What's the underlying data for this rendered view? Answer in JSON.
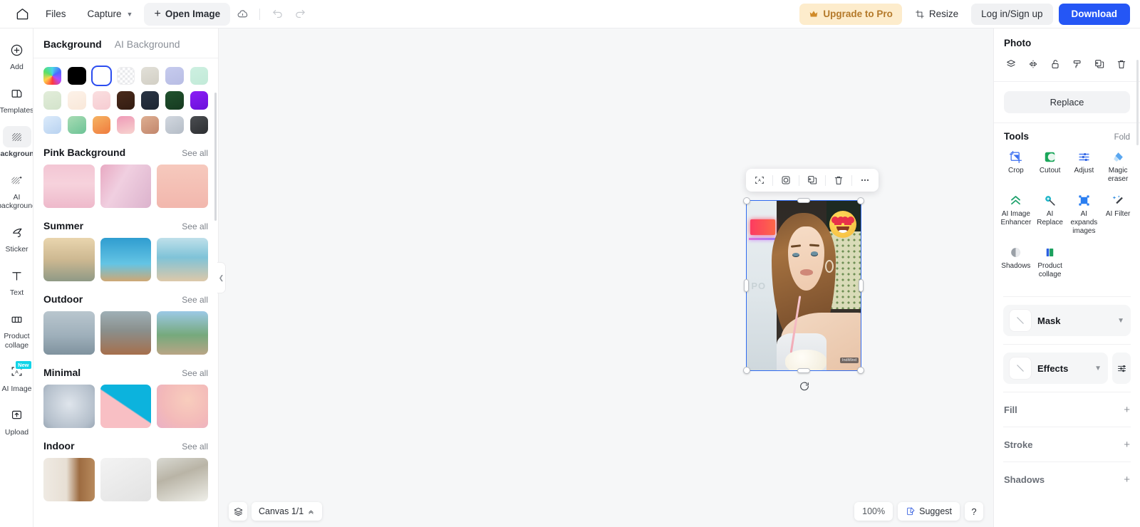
{
  "topbar": {
    "home_icon": "home-icon",
    "files_label": "Files",
    "capture_label": "Capture",
    "open_image_label": "Open Image",
    "cloud_icon": "cloud-upload-icon",
    "undo_icon": "undo-icon",
    "redo_icon": "redo-icon",
    "upgrade_label": "Upgrade to Pro",
    "crown_icon": "crown-icon",
    "resize_label": "Resize",
    "resize_icon": "resize-icon",
    "login_label": "Log in/Sign up",
    "download_label": "Download",
    "accent_blue": "#2556f5",
    "pro_bg": "#fdeccc",
    "pro_text": "#b4792a"
  },
  "rail": {
    "items": [
      {
        "label": "Add",
        "icon": "plus-circle-icon",
        "active": false,
        "badge": ""
      },
      {
        "label": "Templates",
        "icon": "templates-icon",
        "active": false,
        "badge": ""
      },
      {
        "label": "Background",
        "icon": "background-hatch-icon",
        "active": true,
        "badge": ""
      },
      {
        "label": "AI background",
        "icon": "ai-background-icon",
        "active": false,
        "badge": ""
      },
      {
        "label": "Sticker",
        "icon": "sticker-icon",
        "active": false,
        "badge": ""
      },
      {
        "label": "Text",
        "icon": "text-icon",
        "active": false,
        "badge": ""
      },
      {
        "label": "Product collage",
        "icon": "product-collage-icon",
        "active": false,
        "badge": ""
      },
      {
        "label": "AI Image",
        "icon": "ai-image-icon",
        "active": false,
        "badge": "New"
      },
      {
        "label": "Upload",
        "icon": "upload-icon",
        "active": false,
        "badge": ""
      }
    ]
  },
  "panel": {
    "tabs": [
      {
        "label": "Background",
        "active": true
      },
      {
        "label": "AI Background",
        "active": false
      }
    ],
    "swatches": [
      {
        "name": "rainbow",
        "type": "rainbow",
        "selected": false
      },
      {
        "name": "black",
        "color": "#000000",
        "selected": false
      },
      {
        "name": "white",
        "color": "#ffffff",
        "selected": true
      },
      {
        "name": "transparent",
        "type": "checker",
        "selected": false
      },
      {
        "name": "warm-grey",
        "color": "#d8d5cd",
        "selected": false
      },
      {
        "name": "periwinkle",
        "color": "#c0c4e8",
        "selected": false
      },
      {
        "name": "mint",
        "color": "#c9ecdd",
        "selected": false
      },
      {
        "name": "pale-green",
        "color": "#dbe7d4",
        "selected": false
      },
      {
        "name": "cream",
        "color": "#fbeee2",
        "selected": false
      },
      {
        "name": "blush",
        "color": "#f8d7d9",
        "selected": false
      },
      {
        "name": "dark-brown",
        "color": "#3e2418",
        "selected": false
      },
      {
        "name": "navy",
        "color": "#222c3a",
        "selected": false
      },
      {
        "name": "forest",
        "color": "#1e4a2a",
        "selected": false
      },
      {
        "name": "violet",
        "color": "#7a18f0",
        "selected": false
      },
      {
        "name": "sky-gradient",
        "color": "#cfe2f7",
        "selected": false
      },
      {
        "name": "green-gradient",
        "color": "#8fd2a6",
        "selected": false
      },
      {
        "name": "orange-gradient",
        "color": "#f49a4e",
        "selected": false
      },
      {
        "name": "pink-gradient",
        "color": "#efa9bd",
        "selected": false
      },
      {
        "name": "tan-gradient",
        "color": "#d3a085",
        "selected": false
      },
      {
        "name": "silver-gradient",
        "color": "#c3c9d2",
        "selected": false
      },
      {
        "name": "charcoal-gradient",
        "color": "#3a3d40",
        "selected": false
      }
    ],
    "see_all_label": "See all",
    "categories": [
      {
        "title": "Pink Background",
        "thumbs": [
          "pink-petals-podium",
          "pink-curtain-window",
          "pink-tulips-wall"
        ]
      },
      {
        "title": "Summer",
        "thumbs": [
          "beach-palm-stone",
          "pool-water-deck",
          "sandy-beach-sea"
        ]
      },
      {
        "title": "Outdoor",
        "thumbs": [
          "wet-stone-path",
          "cliff-coast-wood",
          "mountain-forest-road"
        ]
      },
      {
        "title": "Minimal",
        "thumbs": [
          "grey-radial-gradient",
          "cyan-pink-diagonal",
          "peach-pink-blur"
        ]
      },
      {
        "title": "Indoor",
        "thumbs": [
          "curtain-wood-wall",
          "white-wall-corner",
          "window-white-flowers"
        ]
      }
    ],
    "collapse_icon": "chevron-left-icon"
  },
  "canvas": {
    "float_tools": [
      {
        "name": "ai-select-icon"
      },
      {
        "name": "cutout-icon"
      },
      {
        "name": "duplicate-icon"
      },
      {
        "name": "delete-icon"
      },
      {
        "name": "more-icon"
      }
    ],
    "rotate_icon": "rotate-icon",
    "image_watermark": "IndiWed",
    "bottom": {
      "layers_icon": "layers-icon",
      "canvas_label": "Canvas 1/1",
      "canvas_caret_icon": "chevron-up-icon",
      "zoom_level": "100%",
      "suggest_label": "Suggest",
      "suggest_icon": "suggest-note-icon",
      "help_label": "?"
    }
  },
  "right_panel": {
    "title": "Photo",
    "header_icons": [
      {
        "name": "layers-order-icon"
      },
      {
        "name": "flip-horizontal-icon"
      },
      {
        "name": "unlock-icon"
      },
      {
        "name": "paint-format-icon"
      },
      {
        "name": "duplicate-icon"
      },
      {
        "name": "delete-icon"
      }
    ],
    "replace_label": "Replace",
    "tools_title": "Tools",
    "fold_label": "Fold",
    "tools": [
      {
        "label": "Crop",
        "icon": "crop-icon",
        "color": "#3b6ff0"
      },
      {
        "label": "Cutout",
        "icon": "cutout-icon",
        "color": "#1aa65a"
      },
      {
        "label": "Adjust",
        "icon": "adjust-icon",
        "color": "#4a7df5"
      },
      {
        "label": "Magic eraser",
        "icon": "magic-eraser-icon",
        "color": "#5aa7f0"
      },
      {
        "label": "AI Image Enhancer",
        "icon": "chevrons-up-icon",
        "color": "#1ba06a"
      },
      {
        "label": "AI Replace",
        "icon": "ai-replace-icon",
        "color": "#1fb5c8"
      },
      {
        "label": "AI expands images",
        "icon": "expand-icon",
        "color": "#2a7ef0"
      },
      {
        "label": "AI Filter",
        "icon": "ai-filter-icon",
        "color": "#2f8ce0"
      },
      {
        "label": "Shadows",
        "icon": "shadows-icon",
        "color": "#7a7f86"
      },
      {
        "label": "Product collage",
        "icon": "product-collage-icon",
        "color": "#1ba05e"
      }
    ],
    "rows": [
      {
        "label": "Mask",
        "thumb": "diagonal-line-thumb",
        "chevron": "chevron-down-icon",
        "has_settings": false
      },
      {
        "label": "Effects",
        "thumb": "diagonal-line-thumb",
        "chevron": "chevron-down-icon",
        "has_settings": true,
        "settings_icon": "sliders-icon"
      }
    ],
    "simple_rows": [
      {
        "label": "Fill",
        "action": "+"
      },
      {
        "label": "Stroke",
        "action": "+"
      },
      {
        "label": "Shadows",
        "action": "+"
      }
    ]
  }
}
